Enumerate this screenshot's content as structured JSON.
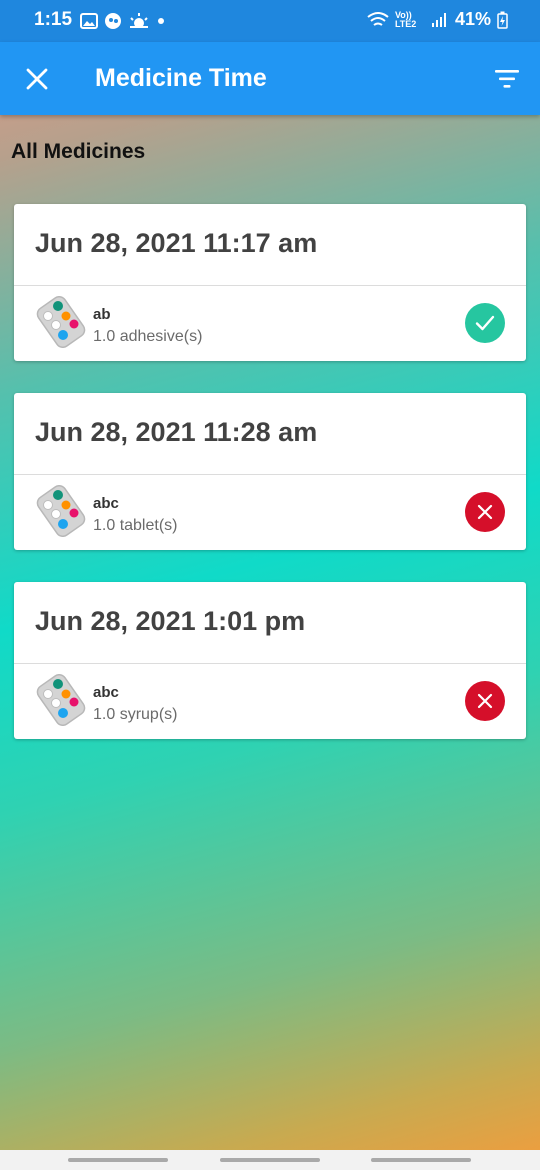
{
  "status_bar": {
    "time": "1:15",
    "battery": "41%",
    "network": "Vo)) LTE2"
  },
  "app_bar": {
    "title": "Medicine Time"
  },
  "section_title": "All Medicines",
  "colors": {
    "primary": "#2196f3",
    "taken": "#26c6a0",
    "missed": "#d50f2a"
  },
  "records": [
    {
      "datetime": "Jun 28, 2021 11:17 am",
      "name": "ab",
      "dose": "1.0 adhesive(s)",
      "status": "taken",
      "status_icon": "check-icon"
    },
    {
      "datetime": "Jun 28, 2021 11:28 am",
      "name": "abc",
      "dose": "1.0 tablet(s)",
      "status": "missed",
      "status_icon": "close-icon"
    },
    {
      "datetime": "Jun 28, 2021 1:01 pm",
      "name": "abc",
      "dose": "1.0 syrup(s)",
      "status": "missed",
      "status_icon": "close-icon"
    }
  ]
}
